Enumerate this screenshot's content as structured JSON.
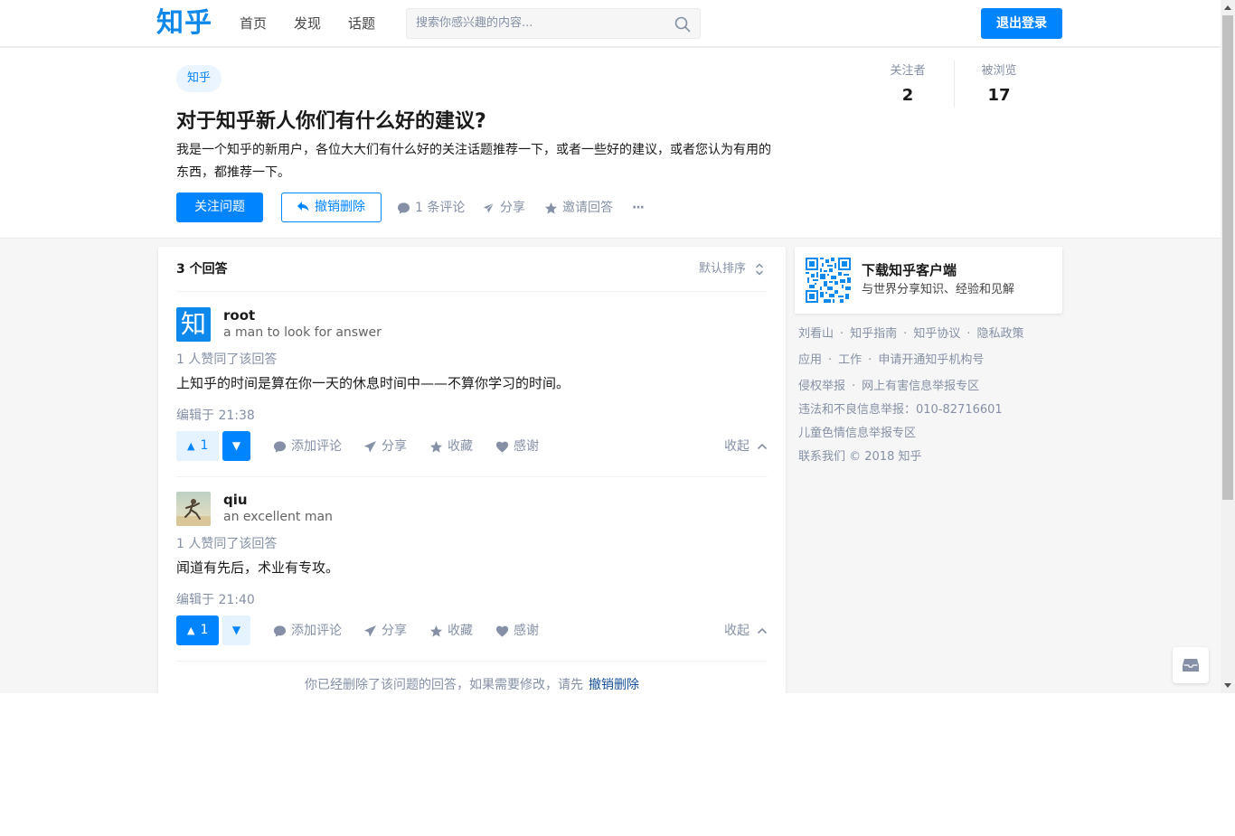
{
  "header": {
    "logo": "知乎",
    "nav": [
      "首页",
      "发现",
      "话题"
    ],
    "search_placeholder": "搜索你感兴趣的内容...",
    "logout_label": "退出登录"
  },
  "question": {
    "topic": "知乎",
    "title": "对于知乎新人你们有什么好的建议?",
    "detail": "我是一个知乎的新用户，各位大大们有什么好的关注话题推荐一下，或者一些好的建议，或者您认为有用的东西，都推荐一下。",
    "follow_label": "关注问题",
    "undo_delete_label": "撤销删除",
    "comment_label": "1 条评论",
    "share_label": "分享",
    "invite_label": "邀请回答",
    "more_label": "···",
    "followers_label": "关注者",
    "followers_value": "2",
    "views_label": "被浏览",
    "views_value": "17"
  },
  "answers": {
    "count_label": "3 个回答",
    "sort_label": "默认排序",
    "items": [
      {
        "author": "root",
        "avatar_text": "知",
        "headline": "a man to look for answer",
        "votes_text": "1 人赞同了该回答",
        "content": "上知乎的时间是算在你一天的休息时间中——不算你学习的时间。",
        "edited": "编辑于 21:38",
        "upvotes": "1",
        "comment_label": "添加评论",
        "share_label": "分享",
        "collect_label": "收藏",
        "thanks_label": "感谢",
        "collapse_label": "收起"
      },
      {
        "author": "qiu",
        "headline": "an excellent man",
        "votes_text": "1 人赞同了该回答",
        "content": "闻道有先后，术业有专攻。",
        "edited": "编辑于 21:40",
        "upvotes": "1",
        "comment_label": "添加评论",
        "share_label": "分享",
        "collect_label": "收藏",
        "thanks_label": "感谢",
        "collapse_label": "收起"
      }
    ],
    "deleted_note": "你已经删除了该问题的回答，如果需要修改，请先",
    "deleted_link": "撤销删除"
  },
  "sidebar": {
    "download_title": "下载知乎客户端",
    "download_subtitle": "与世界分享知识、经验和见解",
    "footer": {
      "row1": [
        "刘看山",
        "知乎指南",
        "知乎协议",
        "隐私政策"
      ],
      "row2": [
        "应用",
        "工作",
        "申请开通知乎机构号"
      ],
      "row3": [
        "侵权举报",
        "网上有害信息举报专区"
      ],
      "row4": "违法和不良信息举报：010-82716601",
      "row5": "儿童色情信息举报专区",
      "row6": "联系我们 © 2018 知乎"
    }
  },
  "colors": {
    "brand": "#0084ff",
    "text_secondary": "#8590a6",
    "page_bg": "#f6f6f6"
  }
}
